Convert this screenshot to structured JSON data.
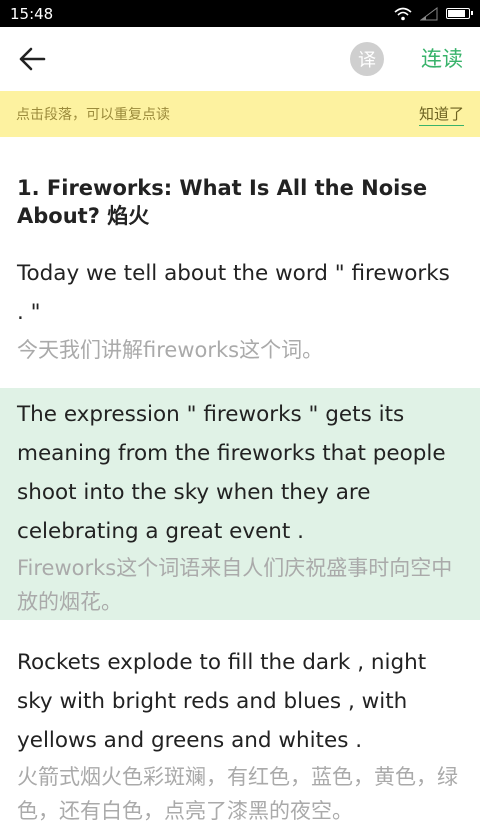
{
  "status_bar": {
    "time": "15:48"
  },
  "app_bar": {
    "translate_label": "译",
    "continuous_label": "连读"
  },
  "tip": {
    "text": "点击段落，可以重复点读",
    "dismiss": "知道了"
  },
  "article": {
    "title": "1. Fireworks: What Is All the Noise About? 焰火",
    "paragraphs": [
      {
        "en": "Today we tell about the word \" fireworks . \"",
        "zh": "今天我们讲解fireworks这个词。",
        "highlighted": false
      },
      {
        "en": "The expression \" fireworks \" gets its meaning from the fireworks that people shoot into the sky when they are celebrating a great event .",
        "zh": "Fireworks这个词语来自人们庆祝盛事时向空中放的烟花。",
        "highlighted": true
      },
      {
        "en": "Rockets explode to fill the dark , night sky with bright reds and blues , with yellows and greens and whites .",
        "zh": "火箭式烟火色彩斑斓，有红色，蓝色，黄色，绿色，还有白色，点亮了漆黑的夜空。",
        "highlighted": false
      }
    ]
  }
}
